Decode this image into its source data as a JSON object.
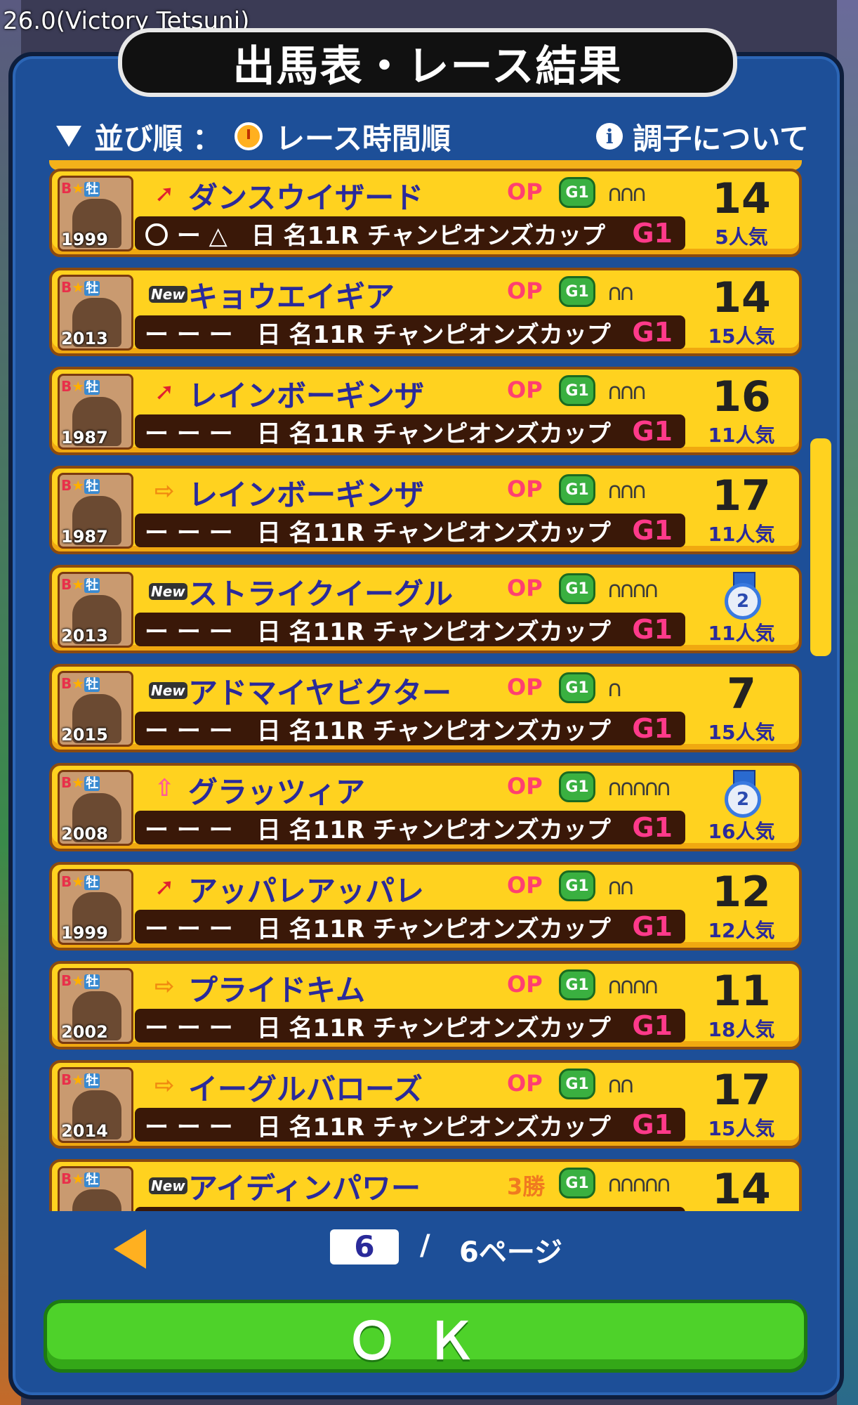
{
  "version_label": "26.0(Victory Tetsuni)",
  "title": "出馬表・レース結果",
  "sort": {
    "label": "並び順",
    "colon": "：",
    "value": "レース時間順"
  },
  "info_label": "調子について",
  "race_name": "日 名11R チャンピオンズカップ",
  "grade": "G1",
  "rows": [
    {
      "year": "1999",
      "arrow": "diag",
      "arrow_glyph": "➚",
      "name": "ダンスウイザード",
      "class": "OP",
      "shoes": "3",
      "marks": "〇 ー △",
      "result": "14",
      "pop": "5人気"
    },
    {
      "year": "2013",
      "arrow": "new",
      "arrow_glyph": "New",
      "name": "キョウエイギア",
      "class": "OP",
      "shoes": "2",
      "marks": "ー ー ー",
      "result": "14",
      "pop": "15人気"
    },
    {
      "year": "1987",
      "arrow": "diag",
      "arrow_glyph": "➚",
      "name": "レインボーギンザ",
      "class": "OP",
      "shoes": "3",
      "marks": "ー ー ー",
      "result": "16",
      "pop": "11人気"
    },
    {
      "year": "1987",
      "arrow": "right",
      "arrow_glyph": "⇨",
      "name": "レインボーギンザ",
      "class": "OP",
      "shoes": "3",
      "marks": "ー ー ー",
      "result": "17",
      "pop": "11人気"
    },
    {
      "year": "2013",
      "arrow": "new",
      "arrow_glyph": "New",
      "name": "ストライクイーグル",
      "class": "OP",
      "shoes": "4",
      "marks": "ー ー ー",
      "result": "2",
      "result_medal": true,
      "pop": "11人気"
    },
    {
      "year": "2015",
      "arrow": "new",
      "arrow_glyph": "New",
      "name": "アドマイヤビクター",
      "class": "OP",
      "shoes": "1",
      "marks": "ー ー ー",
      "result": "7",
      "pop": "15人気"
    },
    {
      "year": "2008",
      "arrow": "up",
      "arrow_glyph": "⇧",
      "name": "グラッツィア",
      "class": "OP",
      "shoes": "5",
      "marks": "ー ー ー",
      "result": "2",
      "result_medal": true,
      "pop": "16人気"
    },
    {
      "year": "1999",
      "arrow": "diag",
      "arrow_glyph": "➚",
      "name": "アッパレアッパレ",
      "class": "OP",
      "shoes": "2",
      "marks": "ー ー ー",
      "result": "12",
      "pop": "12人気"
    },
    {
      "year": "2002",
      "arrow": "right",
      "arrow_glyph": "⇨",
      "name": "プライドキム",
      "class": "OP",
      "shoes": "4",
      "marks": "ー ー ー",
      "result": "11",
      "pop": "18人気"
    },
    {
      "year": "2014",
      "arrow": "right",
      "arrow_glyph": "⇨",
      "name": "イーグルバローズ",
      "class": "OP",
      "shoes": "2",
      "marks": "ー ー ー",
      "result": "17",
      "pop": "15人気"
    },
    {
      "year": "",
      "arrow": "new",
      "arrow_glyph": "New",
      "name": "アイディンパワー",
      "class": "3勝",
      "shoes": "5",
      "marks": "",
      "result": "14",
      "pop": ""
    }
  ],
  "pager": {
    "current": "6",
    "slash": "/",
    "total": "6ページ"
  },
  "ok_label": "ＯＫ"
}
